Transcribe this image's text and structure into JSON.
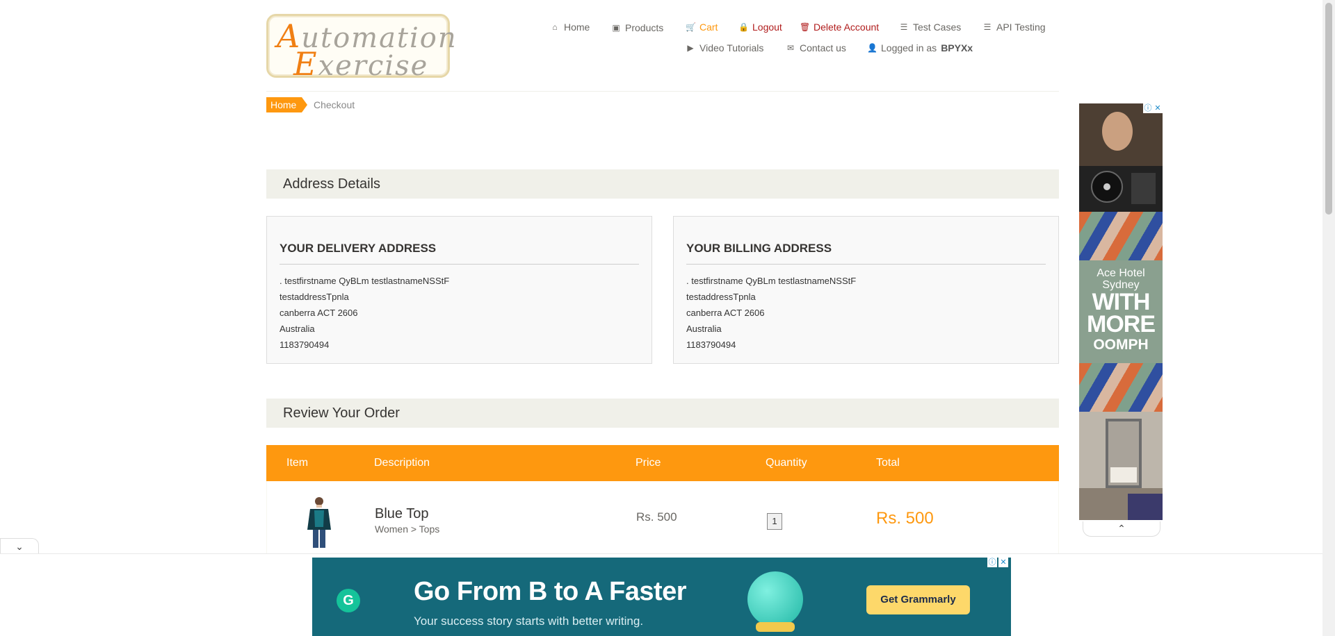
{
  "logo": {
    "line1_cap": "A",
    "line1_rest": "utomation",
    "line2_cap": "E",
    "line2_rest": "xercise"
  },
  "nav": {
    "home": "Home",
    "products": "Products",
    "cart": "Cart",
    "logout": "Logout",
    "delete_account": "Delete Account",
    "test_cases": "Test Cases",
    "api_testing": "API Testing",
    "video_tutorials": "Video Tutorials",
    "contact_us": "Contact us",
    "logged_in_prefix": "Logged in as",
    "username": "BPYXx"
  },
  "breadcrumb": {
    "home": "Home",
    "current": "Checkout"
  },
  "address_section": {
    "title": "Address Details"
  },
  "delivery": {
    "heading": "YOUR DELIVERY ADDRESS",
    "name": ". testfirstname QyBLm testlastnameNSStF",
    "address": "testaddressTpnla",
    "city_state_zip": "canberra ACT 2606",
    "country": "Australia",
    "phone": "1183790494"
  },
  "billing": {
    "heading": "YOUR BILLING ADDRESS",
    "name": ". testfirstname QyBLm testlastnameNSStF",
    "address": "testaddressTpnla",
    "city_state_zip": "canberra ACT 2606",
    "country": "Australia",
    "phone": "1183790494"
  },
  "review": {
    "title": "Review Your Order"
  },
  "table": {
    "headers": {
      "item": "Item",
      "description": "Description",
      "price": "Price",
      "quantity": "Quantity",
      "total": "Total"
    },
    "rows": [
      {
        "name": "Blue Top",
        "category": "Women > Tops",
        "price": "Rs. 500",
        "quantity": "1",
        "total": "Rs. 500"
      }
    ]
  },
  "side_ad": {
    "line1": "Ace Hotel",
    "line2": "Sydney",
    "big1": "WITH",
    "big2": "MORE",
    "big3": "OOMPH"
  },
  "bottom_ad": {
    "headline": "Go From B to A Faster",
    "sub": "Your success story starts with better writing.",
    "cta": "Get Grammarly",
    "logo_letter": "G"
  },
  "colors": {
    "accent": "#FE980F",
    "section_bg": "#f0f0e9",
    "danger": "#b01c1c"
  },
  "icons": {
    "home": "home-icon",
    "products": "briefcase-icon",
    "cart": "cart-icon",
    "logout": "lock-icon",
    "delete": "trash-icon",
    "list": "list-icon",
    "video": "youtube-icon",
    "contact": "envelope-icon",
    "user": "user-icon"
  }
}
